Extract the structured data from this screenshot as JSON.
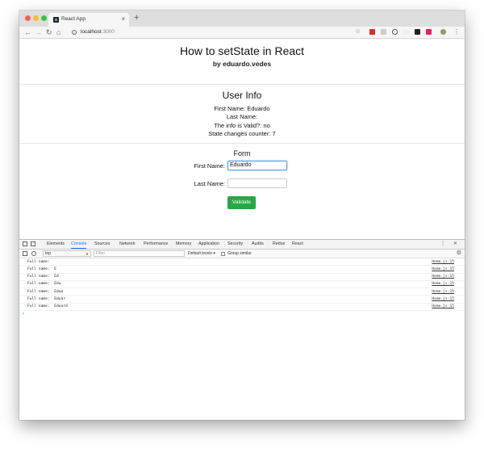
{
  "browser": {
    "tab_title": "React App",
    "tab_close": "×",
    "new_tab": "+",
    "url_host": "localhost",
    "url_port": ":3000"
  },
  "page": {
    "title": "How to setState in React",
    "byline": "by eduardo.vedes",
    "user_info": {
      "heading": "User Info",
      "first_name_line": "First Name: Eduardo",
      "last_name_line": "Last Name:",
      "valid_line": "The info is Valid?: no",
      "counter_line": "State changes counter: 7"
    },
    "form": {
      "heading": "Form",
      "first_name_label": "First Name:",
      "first_name_value": "Eduardo",
      "last_name_label": "Last Name:",
      "last_name_value": "",
      "validate_label": "Validate"
    }
  },
  "devtools": {
    "tabs": [
      "Elements",
      "Console",
      "Sources",
      "Network",
      "Performance",
      "Memory",
      "Application",
      "Security",
      "Audits",
      "Redux",
      "React"
    ],
    "active_tab": "Console",
    "context": "top",
    "filter_placeholder": "Filter",
    "levels": "Default levels ▾",
    "group_similar": "Group similar",
    "logs": [
      {
        "text": "Full name: ",
        "src": "Home.js:15"
      },
      {
        "text": "Full name:  E",
        "src": "Home.js:15"
      },
      {
        "text": "Full name:  Ed",
        "src": "Home.js:15"
      },
      {
        "text": "Full name:  Edu",
        "src": "Home.js:15"
      },
      {
        "text": "Full name:  Edua",
        "src": "Home.js:15"
      },
      {
        "text": "Full name:  Eduar",
        "src": "Home.js:15"
      },
      {
        "text": "Full name:  Eduard",
        "src": "Home.js:15"
      }
    ],
    "prompt": "›"
  },
  "colors": {
    "validate_button": "#28a745",
    "devtools_accent": "#1a73e8"
  }
}
